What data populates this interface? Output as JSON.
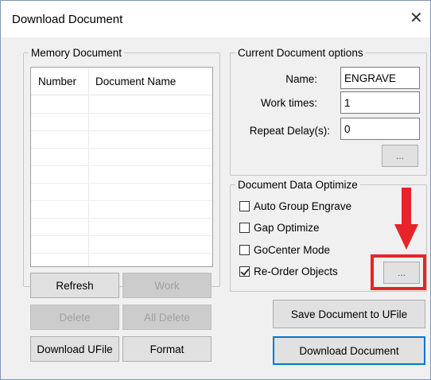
{
  "window": {
    "title": "Download Document",
    "close_glyph": "✕"
  },
  "memory": {
    "group_label": "Memory Document",
    "columns": [
      "Number",
      "Document Name"
    ],
    "buttons": {
      "refresh": "Refresh",
      "work": "Work",
      "delete": "Delete",
      "all_delete": "All Delete",
      "download_ufile": "Download UFile",
      "format": "Format"
    }
  },
  "options": {
    "group_label": "Current Document options",
    "name_label": "Name:",
    "name_value": "ENGRAVE",
    "work_times_label": "Work times:",
    "work_times_value": "1",
    "repeat_delay_label": "Repeat Delay(s):",
    "repeat_delay_value": "0",
    "more_button": "..."
  },
  "optimize": {
    "group_label": "Document Data Optimize",
    "auto_group": {
      "label": "Auto Group Engrave",
      "checked": false
    },
    "gap_optimize": {
      "label": "Gap Optimize",
      "checked": false
    },
    "gocenter_mode": {
      "label": "GoCenter Mode",
      "checked": false
    },
    "reorder_objects": {
      "label": "Re-Order Objects",
      "checked": true
    },
    "more_button": "..."
  },
  "actions": {
    "save_to_ufile": "Save Document to UFile",
    "download_document": "Download Document"
  },
  "annotation_color": "#e8232a"
}
